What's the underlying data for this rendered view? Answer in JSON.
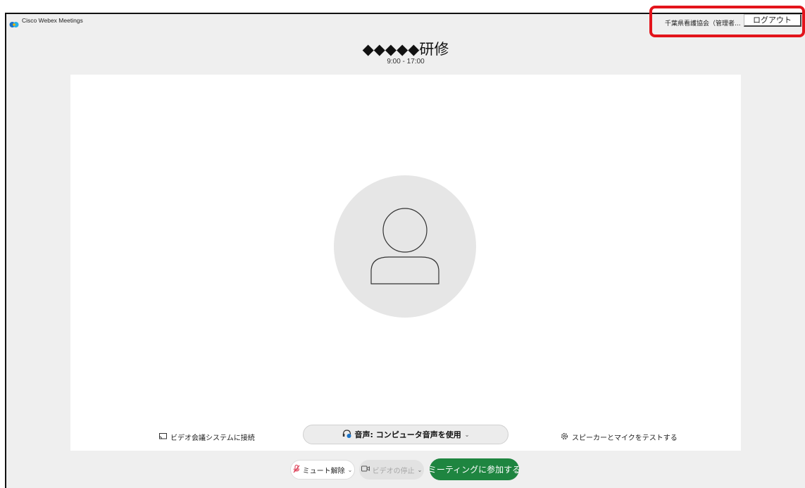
{
  "app": {
    "title": "Cisco Webex Meetings"
  },
  "account": {
    "user": "千葉県看護協会（管理者...",
    "logout_label": "ログアウト"
  },
  "meeting": {
    "title": "◆◆◆◆◆研修",
    "time": "9:00 - 17:00"
  },
  "preview": {
    "connect_video_label": "ビデオ会議システムに接続",
    "audio_label": "音声: コンピュータ音声を使用",
    "test_audio_label": "スピーカーとマイクをテストする"
  },
  "controls": {
    "unmute_label": "ミュート解除",
    "video_label": "ビデオの停止",
    "join_label": "ミーティングに参加する"
  },
  "colors": {
    "join": "#1e8540",
    "highlight": "#e3141b",
    "mic_muted": "#d9324b"
  }
}
